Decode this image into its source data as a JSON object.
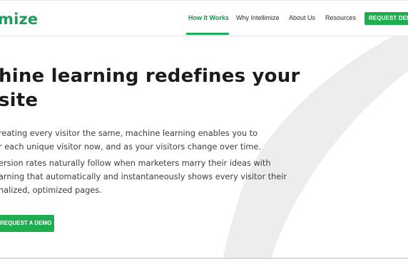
{
  "brand": {
    "logo_text": "mize",
    "accent_color": "#1fae4f"
  },
  "nav": {
    "items": [
      {
        "label": "How It Works",
        "active": true
      },
      {
        "label": "Why Intellimize",
        "active": false
      },
      {
        "label": "About Us",
        "active": false
      },
      {
        "label": "Resources",
        "active": false
      }
    ],
    "cta_label": "REQUEST DEMO"
  },
  "hero": {
    "title_lines": [
      "hine learning redefines your",
      "site"
    ],
    "paragraph1_lines": [
      "reating every visitor the same, machine learning enables you to",
      "r each unique visitor now, and as your visitors change over time."
    ],
    "paragraph2_lines": [
      "ersion rates naturally follow when marketers marry their ideas with",
      "arning that automatically and instantaneously shows every visitor their",
      "nalized, optimized pages."
    ],
    "cta_label": "REQUEST A DEMO"
  }
}
